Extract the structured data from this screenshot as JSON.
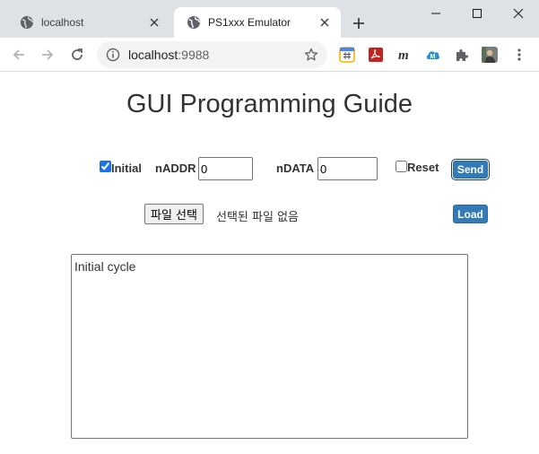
{
  "browser": {
    "tabs": [
      {
        "title": "localhost",
        "active": false
      },
      {
        "title": "PS1xxx Emulator",
        "active": true
      }
    ],
    "new_tab_icon": "plus-icon",
    "window_controls": [
      "minimize-icon",
      "maximize-icon",
      "close-icon"
    ],
    "url_host": "localhost",
    "url_port": ":9988",
    "extensions": [
      "hashtag-extension-icon",
      "acrobat-extension-icon",
      "m-extension-icon",
      "cloud-m-extension-icon",
      "puzzle-icon",
      "profile-avatar",
      "kebab-menu-icon"
    ],
    "colors": {
      "tabstrip": "#dee1e6",
      "omnibox": "#f1f3f4"
    }
  },
  "page": {
    "title": "GUI Programming Guide",
    "controls": {
      "initial_label": "Initial",
      "initial_checked": true,
      "naddr_label": "nADDR",
      "naddr_value": "0",
      "ndata_label": "nDATA",
      "ndata_value": "0",
      "reset_label": "Reset",
      "reset_checked": false,
      "send_label": "Send"
    },
    "file": {
      "choose_label": "파일 선택",
      "status": "선택된 파일 없음",
      "load_label": "Load"
    },
    "log_text": "Initial cycle",
    "colors": {
      "button": "#337ab7",
      "text": "#333333"
    }
  }
}
